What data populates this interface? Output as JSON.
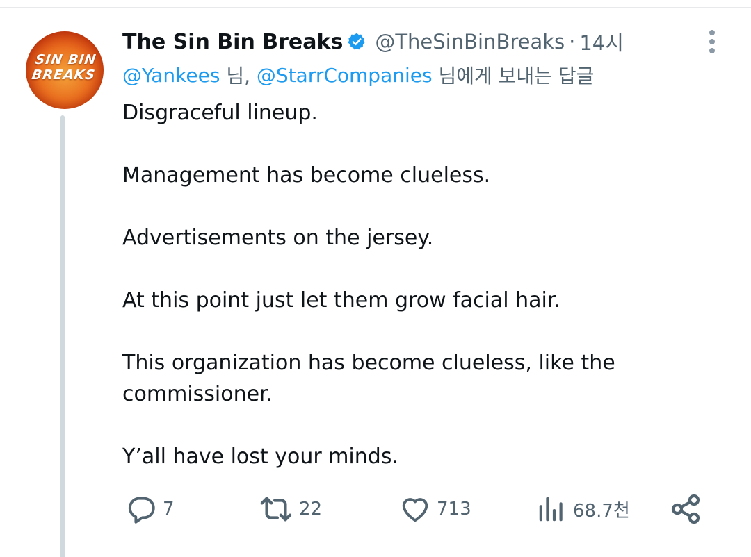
{
  "author": {
    "display_name": "The Sin Bin Breaks",
    "handle": "@TheSinBinBreaks",
    "separator": "·",
    "time": "14시",
    "avatar_line1": "SIN BIN",
    "avatar_line2": "BREAKS",
    "verified_icon": "verified-badge-icon"
  },
  "reply_to": {
    "mention1": "@Yankees",
    "sep1": " 님, ",
    "mention2": "@StarrCompanies",
    "suffix": " 님에게 보내는 답글"
  },
  "tweet": {
    "paragraphs": [
      "Disgraceful lineup.",
      "Management has become clueless.",
      "Advertisements on the jersey.",
      "At this point just let them grow facial hair.",
      "This organization has become clueless, like the commissioner.",
      "Y’all have lost your minds."
    ]
  },
  "actions": {
    "reply_count": "7",
    "retweet_count": "22",
    "like_count": "713",
    "views_count": "68.7천"
  },
  "colors": {
    "accent": "#1d9bf0",
    "secondary_text": "#536471",
    "primary_text": "#0f1419",
    "thread_line": "#cfd9de"
  }
}
